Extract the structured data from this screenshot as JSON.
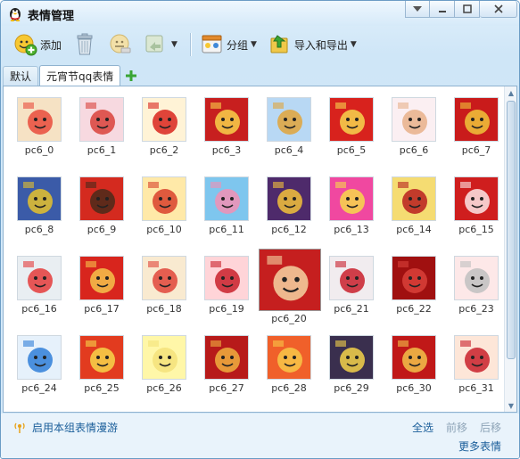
{
  "window": {
    "title": "表情管理"
  },
  "toolbar": {
    "add_label": "添加",
    "group_label": "分组",
    "import_export_label": "导入和导出"
  },
  "tabs": [
    {
      "label": "默认"
    },
    {
      "label": "元宵节qq表情"
    }
  ],
  "emoticons": [
    {
      "label": "pc6_0"
    },
    {
      "label": "pc6_1"
    },
    {
      "label": "pc6_2"
    },
    {
      "label": "pc6_3"
    },
    {
      "label": "pc6_4"
    },
    {
      "label": "pc6_5"
    },
    {
      "label": "pc6_6"
    },
    {
      "label": "pc6_7"
    },
    {
      "label": "pc6_8"
    },
    {
      "label": "pc6_9"
    },
    {
      "label": "pc6_10"
    },
    {
      "label": "pc6_11"
    },
    {
      "label": "pc6_12"
    },
    {
      "label": "pc6_13"
    },
    {
      "label": "pc6_14"
    },
    {
      "label": "pc6_15"
    },
    {
      "label": "pc6_16"
    },
    {
      "label": "pc6_17"
    },
    {
      "label": "pc6_18"
    },
    {
      "label": "pc6_19"
    },
    {
      "label": "pc6_20"
    },
    {
      "label": "pc6_21"
    },
    {
      "label": "pc6_22"
    },
    {
      "label": "pc6_23"
    },
    {
      "label": "pc6_24"
    },
    {
      "label": "pc6_25"
    },
    {
      "label": "pc6_26"
    },
    {
      "label": "pc6_27"
    },
    {
      "label": "pc6_28"
    },
    {
      "label": "pc6_29"
    },
    {
      "label": "pc6_30"
    },
    {
      "label": "pc6_31"
    }
  ],
  "footer": {
    "roaming_label": "启用本组表情漫游",
    "select_all_label": "全选",
    "move_forward_label": "前移",
    "move_back_label": "后移",
    "more_label": "更多表情"
  },
  "colors": {
    "accent": "#1a5e9a",
    "window_border": "#6b9cc5",
    "panel_border": "#8fb2cf"
  }
}
